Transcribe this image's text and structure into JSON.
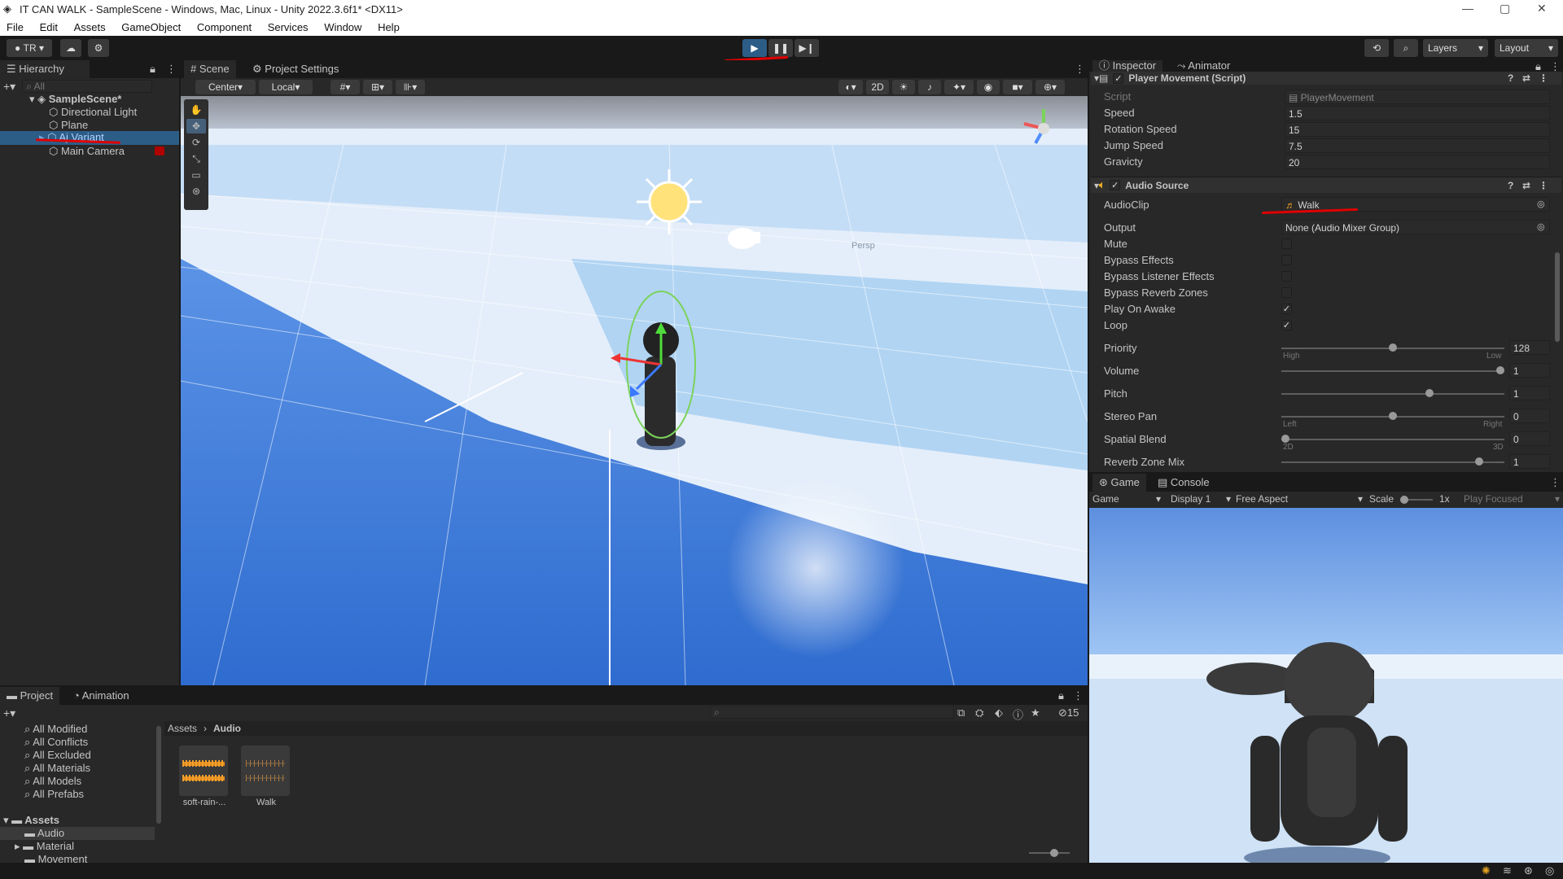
{
  "window": {
    "title": "IT CAN WALK - SampleScene - Windows, Mac, Linux - Unity 2022.3.6f1* <DX11>"
  },
  "menu": [
    "File",
    "Edit",
    "Assets",
    "GameObject",
    "Component",
    "Services",
    "Window",
    "Help"
  ],
  "toolbar": {
    "account": "TR",
    "layers": "Layers",
    "layout": "Layout"
  },
  "hierarchy": {
    "tab": "Hierarchy",
    "search_placeholder": "All",
    "scene": "SampleScene*",
    "items": [
      "Directional Light",
      "Plane",
      "Aj Variant",
      "Main Camera"
    ]
  },
  "scene_view": {
    "tabs": [
      "Scene",
      "Project Settings"
    ],
    "pivot": "Center",
    "space": "Local",
    "mode_2d": "2D",
    "persp": "Persp"
  },
  "inspector": {
    "tabs": [
      "Inspector",
      "Animator"
    ],
    "player_movement": {
      "title": "Player Movement (Script)",
      "script_label": "Script",
      "script_value": "PlayerMovement",
      "speed_label": "Speed",
      "speed": "1.5",
      "rotation_label": "Rotation Speed",
      "rotation": "15",
      "jump_label": "Jump Speed",
      "jump": "7.5",
      "gravity_label": "Gravicty",
      "gravity": "20"
    },
    "audio_source": {
      "title": "Audio Source",
      "audioclip_label": "AudioClip",
      "audioclip": "Walk",
      "output_label": "Output",
      "output": "None (Audio Mixer Group)",
      "mute_label": "Mute",
      "bypass_effects_label": "Bypass Effects",
      "bypass_listener_label": "Bypass Listener Effects",
      "bypass_reverb_label": "Bypass Reverb Zones",
      "play_on_awake_label": "Play On Awake",
      "loop_label": "Loop",
      "priority_label": "Priority",
      "priority": "128",
      "priority_level": 0.5,
      "priority_low": "High",
      "priority_high": "Low",
      "volume_label": "Volume",
      "volume": "1",
      "volume_level": 1.0,
      "pitch_label": "Pitch",
      "pitch": "1",
      "pitch_level": 0.67,
      "stereo_label": "Stereo Pan",
      "stereo": "0",
      "stereo_level": 0.5,
      "stereo_left": "Left",
      "stereo_right": "Right",
      "spatial_label": "Spatial Blend",
      "spatial": "0",
      "spatial_level": 0.0,
      "spatial_left": "2D",
      "spatial_right": "3D",
      "reverb_label": "Reverb Zone Mix",
      "reverb": "1",
      "reverb_level": 0.9
    },
    "checkboxes": {
      "mute": false,
      "bypass_effects": false,
      "bypass_listener": false,
      "bypass_reverb": false,
      "play_on_awake": true,
      "loop": true
    }
  },
  "game_view": {
    "tabs": [
      "Game",
      "Console"
    ],
    "mode": "Game",
    "display": "Display 1",
    "aspect": "Free Aspect",
    "scale_label": "Scale",
    "scale": "1x",
    "play_focused": "Play Focused"
  },
  "project": {
    "tabs": [
      "Project",
      "Animation"
    ],
    "favorites": [
      "All Modified",
      "All Conflicts",
      "All Excluded",
      "All Materials",
      "All Models",
      "All Prefabs"
    ],
    "assets_root": "Assets",
    "folders": [
      "Audio",
      "Material",
      "Movement"
    ],
    "breadcrumb": [
      "Assets",
      "Audio"
    ],
    "files": [
      "soft-rain-...",
      "Walk"
    ],
    "hidden_count": "15"
  },
  "colors": {
    "accent": "#2c5d87",
    "redline": "#e00000",
    "selection": "#2c5d87",
    "sky": "#d8e4f4",
    "floor": "#3a7ad6"
  }
}
